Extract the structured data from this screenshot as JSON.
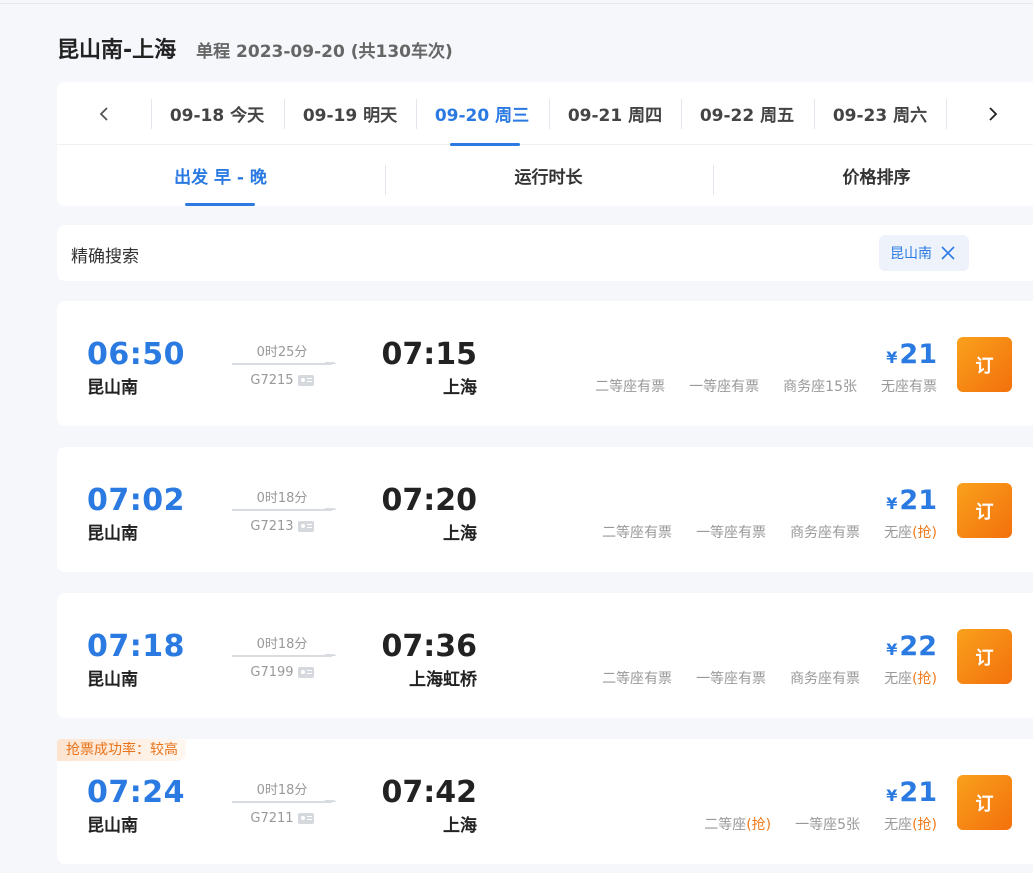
{
  "header": {
    "route": "昆山南-上海",
    "summary": "单程 2023-09-20 (共130车次)"
  },
  "dates": [
    {
      "label": "09-18 今天",
      "active": false
    },
    {
      "label": "09-19 明天",
      "active": false
    },
    {
      "label": "09-20 周三",
      "active": true
    },
    {
      "label": "09-21 周四",
      "active": false
    },
    {
      "label": "09-22 周五",
      "active": false
    },
    {
      "label": "09-23 周六",
      "active": false
    }
  ],
  "sort_tabs": [
    {
      "label": "出发 早 - 晚",
      "active": true
    },
    {
      "label": "运行时长",
      "active": false
    },
    {
      "label": "价格排序",
      "active": false
    }
  ],
  "search": {
    "label": "精确搜索",
    "chip": "昆山南"
  },
  "trains": [
    {
      "dep_time": "06:50",
      "dep_station": "昆山南",
      "duration": "0时25分",
      "train_no": "G7215",
      "arr_time": "07:15",
      "arr_station": "上海",
      "currency": "¥",
      "price": "21",
      "seats": [
        {
          "name": "二等座",
          "status": "有票",
          "grab": false
        },
        {
          "name": "一等座",
          "status": "有票",
          "grab": false
        },
        {
          "name": "商务座",
          "status": "15张",
          "grab": false
        },
        {
          "name": "无座",
          "status": "有票",
          "grab": false
        }
      ],
      "book": "订"
    },
    {
      "dep_time": "07:02",
      "dep_station": "昆山南",
      "duration": "0时18分",
      "train_no": "G7213",
      "arr_time": "07:20",
      "arr_station": "上海",
      "currency": "¥",
      "price": "21",
      "seats": [
        {
          "name": "二等座",
          "status": "有票",
          "grab": false
        },
        {
          "name": "一等座",
          "status": "有票",
          "grab": false
        },
        {
          "name": "商务座",
          "status": "有票",
          "grab": false
        },
        {
          "name": "无座",
          "status": "(抢)",
          "grab": true
        }
      ],
      "book": "订"
    },
    {
      "dep_time": "07:18",
      "dep_station": "昆山南",
      "duration": "0时18分",
      "train_no": "G7199",
      "arr_time": "07:36",
      "arr_station": "上海虹桥",
      "currency": "¥",
      "price": "22",
      "seats": [
        {
          "name": "二等座",
          "status": "有票",
          "grab": false
        },
        {
          "name": "一等座",
          "status": "有票",
          "grab": false
        },
        {
          "name": "商务座",
          "status": "有票",
          "grab": false
        },
        {
          "name": "无座",
          "status": "(抢)",
          "grab": true
        }
      ],
      "book": "订"
    },
    {
      "badge": "抢票成功率：较高",
      "dep_time": "07:24",
      "dep_station": "昆山南",
      "duration": "0时18分",
      "train_no": "G7211",
      "arr_time": "07:42",
      "arr_station": "上海",
      "currency": "¥",
      "price": "21",
      "seats": [
        {
          "name": "二等座",
          "status": "(抢)",
          "grab": true
        },
        {
          "name": "一等座",
          "status": "5张",
          "grab": false
        },
        {
          "name": "无座",
          "status": "(抢)",
          "grab": true
        }
      ],
      "book": "订"
    }
  ],
  "icons": {
    "prev": "chevron-left-icon",
    "next": "chevron-right-icon",
    "clear": "close-icon",
    "train_info": "id-card-icon"
  },
  "colors": {
    "accent": "#2a7ae2",
    "book_button": "#f3700c",
    "grab": "#f07a1c"
  }
}
